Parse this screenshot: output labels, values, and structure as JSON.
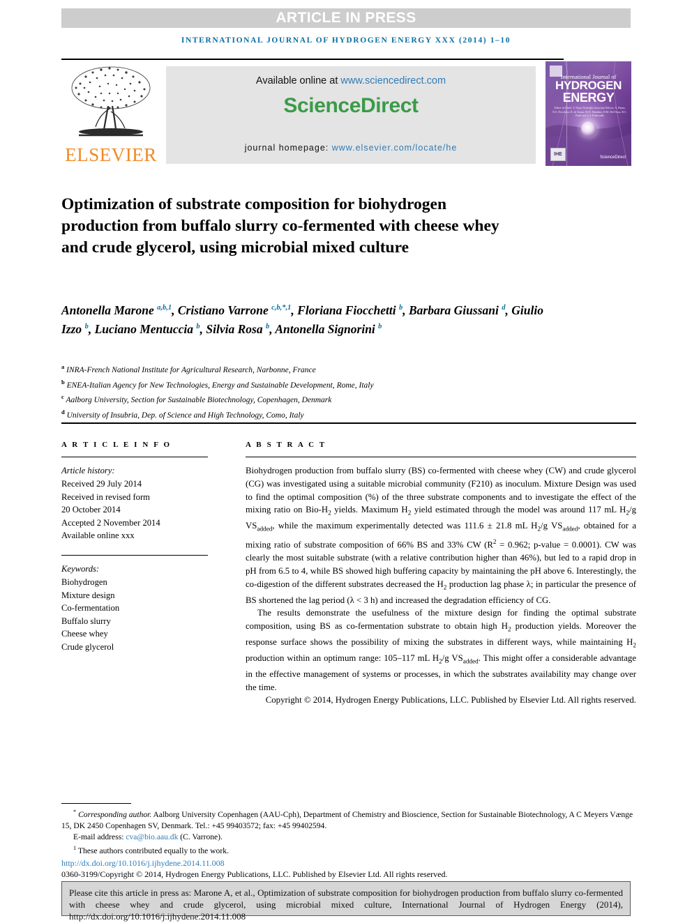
{
  "banner": {
    "press_label": "ARTICLE IN PRESS",
    "running_head": "INTERNATIONAL JOURNAL OF HYDROGEN ENERGY XXX (2014) 1–10"
  },
  "masthead": {
    "publisher_wordmark": "ELSEVIER",
    "available_prefix": "Available online at ",
    "available_url": "www.sciencedirect.com",
    "sciencedirect_logo": "ScienceDirect",
    "homepage_prefix": "journal homepage: ",
    "homepage_url": "www.elsevier.com/locate/he",
    "cover": {
      "line1": "International Journal of",
      "line2": "HYDROGEN",
      "line3": "ENERGY",
      "editors": "Editor-in-Chief: T. Nejat Veziroğlu   Associate Editors: A. Bejan, D.S. Ferrokian, R. de Souza, M.D. Mandina, D.M. Del Duca, B.C. Punk and A.S. Pedrosulla",
      "badge": "IHE",
      "sciencedirect_mark": "ScienceDirect"
    }
  },
  "article": {
    "title": "Optimization of substrate composition for biohydrogen production from buffalo slurry co-fermented with cheese whey and crude glycerol, using microbial mixed culture",
    "authors_html": "Antonella Marone <sup>a,b,1</sup>, Cristiano Varrone <sup>c,b,*,1</sup>, Floriana Fiocchetti <sup>b</sup>, Barbara Giussani <sup>d</sup>, Giulio Izzo <sup>b</sup>, Luciano Mentuccia <sup>b</sup>, Silvia Rosa <sup>b</sup>, Antonella Signorini <sup>b</sup>",
    "affiliations": [
      {
        "marker": "a",
        "text": "INRA-French National Institute for Agricultural Research, Narbonne, France"
      },
      {
        "marker": "b",
        "text": "ENEA-Italian Agency for New Technologies, Energy and Sustainable Development, Rome, Italy"
      },
      {
        "marker": "c",
        "text": "Aalborg University, Section for Sustainable Biotechnology, Copenhagen, Denmark"
      },
      {
        "marker": "d",
        "text": "University of Insubria, Dep. of Science and High Technology, Como, Italy"
      }
    ]
  },
  "article_info": {
    "heading": "A R T I C L E   I N F O",
    "history_label": "Article history:",
    "history": [
      "Received 29 July 2014",
      "Received in revised form",
      "20 October 2014",
      "Accepted 2 November 2014",
      "Available online xxx"
    ],
    "keywords_label": "Keywords:",
    "keywords": [
      "Biohydrogen",
      "Mixture design",
      "Co-fermentation",
      "Buffalo slurry",
      "Cheese whey",
      "Crude glycerol"
    ]
  },
  "abstract": {
    "heading": "A B S T R A C T",
    "paragraph1_html": "Biohydrogen production from buffalo slurry (BS) co-fermented with cheese whey (CW) and crude glycerol (CG) was investigated using a suitable microbial community (F210) as inoculum. Mixture Design was used to find the optimal composition (%) of the three substrate components and to investigate the effect of the mixing ratio on Bio-H<sub>2</sub> yields. Maximum H<sub>2</sub> yield estimated through the model was around 117 mL H<sub>2</sub>/g VS<sub>added</sub>, while the maximum experimentally detected was 111.6 ± 21.8 mL H<sub>2</sub>/g VS<sub>added</sub>, obtained for a mixing ratio of substrate composition of 66% BS and 33% CW (R<sup>2</sup> = 0.962; p-value = 0.0001). CW was clearly the most suitable substrate (with a relative contribution higher than 46%), but led to a rapid drop in pH from 6.5 to 4, while BS showed high buffering capacity by maintaining the pH above 6. Interestingly, the co-digestion of the different substrates decreased the H<sub>2</sub> production lag phase λ; in particular the presence of BS shortened the lag period (λ &lt; 3 h) and increased the degradation efficiency of CG.",
    "paragraph2_html": "The results demonstrate the usefulness of the mixture design for finding the optimal substrate composition, using BS as co-fermentation substrate to obtain high H<sub>2</sub> production yields. Moreover the response surface shows the possibility of mixing the substrates in different ways, while maintaining H<sub>2</sub> production within an optimum range: 105–117 mL H<sub>2</sub>/g VS<sub>added</sub>. This might offer a considerable advantage in the effective management of systems or processes, in which the substrates availability may change over the time.",
    "copyright": "Copyright © 2014, Hydrogen Energy Publications, LLC. Published by Elsevier Ltd. All rights reserved."
  },
  "footnotes": {
    "corresponding_html": "<sup>*</sup> <i>Corresponding author.</i> Aalborg University Copenhagen (AAU-Cph), Department of Chemistry and Bioscience, Section for Sustainable Biotechnology, A C Meyers Vænge 15, DK 2450 Copenhagen SV, Denmark. Tel.: +45 99403572; fax: +45 99402594.",
    "email_prefix": "E-mail address: ",
    "email": "cva@bio.aau.dk",
    "email_suffix": " (C. Varrone).",
    "equal_contrib_html": "<sup>1</sup> These authors contributed equally to the work.",
    "doi": "http://dx.doi.org/10.1016/j.ijhydene.2014.11.008",
    "issn_line": "0360-3199/Copyright © 2014, Hydrogen Energy Publications, LLC. Published by Elsevier Ltd. All rights reserved."
  },
  "citation_box": {
    "text": "Please cite this article in press as: Marone A, et al., Optimization of substrate composition for biohydrogen production from buffalo slurry co-fermented with cheese whey and crude glycerol, using microbial mixed culture, International Journal of Hydrogen Energy (2014), http://dx.doi.org/10.1016/j.ijhydene.2014.11.008"
  },
  "colors": {
    "journal_blue": "#0a6ea1",
    "link_blue": "#2e7cb8",
    "elsevier_orange": "#f08a24",
    "sciencedirect_green": "#3a9b48",
    "banner_gray": "#cdcdcd",
    "band_gray": "#e4e4e4",
    "cite_gray": "#d6d6d6"
  }
}
